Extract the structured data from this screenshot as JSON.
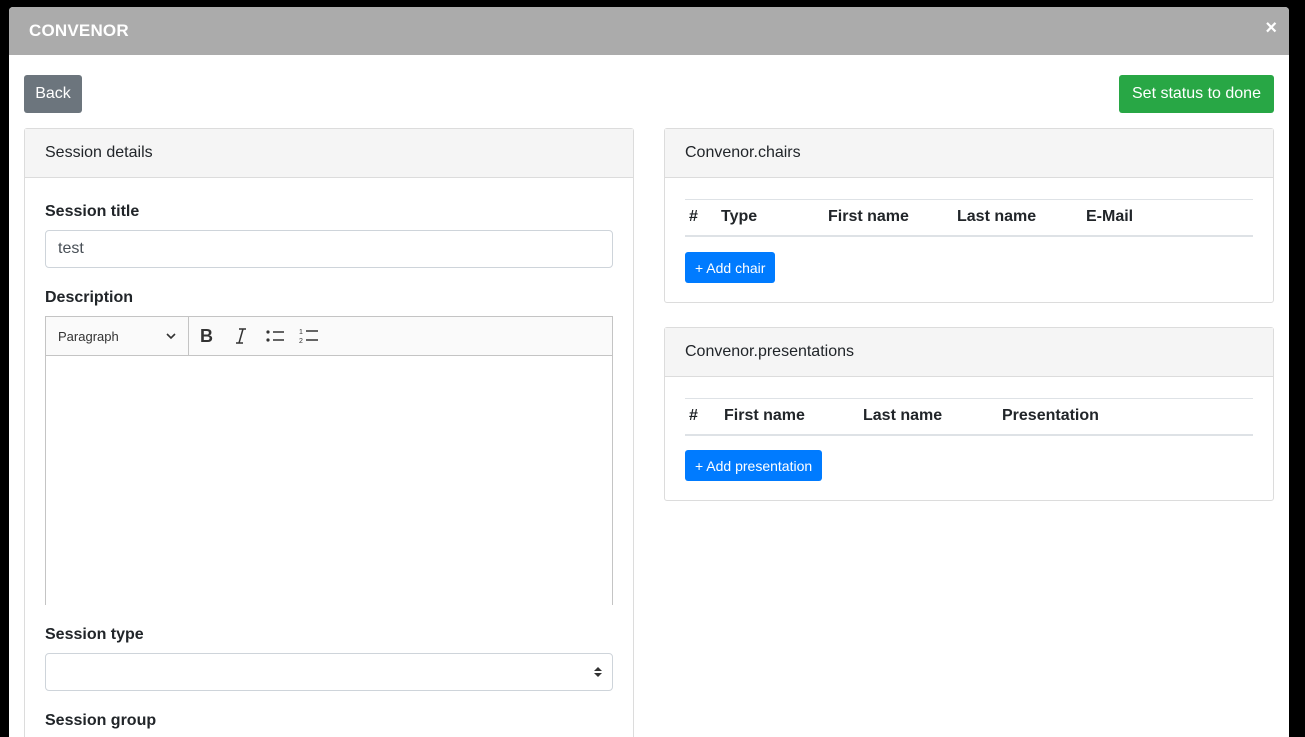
{
  "modal": {
    "title": "CONVENOR",
    "close_glyph": "×"
  },
  "actions": {
    "back_label": "Back",
    "done_label": "Set status to done"
  },
  "session": {
    "header": "Session details",
    "title_label": "Session title",
    "title_value": "test",
    "description_label": "Description",
    "editor": {
      "block_style": "Paragraph",
      "tools": [
        "bold-icon",
        "italic-icon",
        "bulleted-list-icon",
        "numbered-list-icon"
      ]
    },
    "type_label": "Session type",
    "type_value": "",
    "group_label": "Session group"
  },
  "chairs": {
    "header": "Convenor.chairs",
    "columns": [
      "#",
      "Type",
      "First name",
      "Last name",
      "E-Mail"
    ],
    "add_label": "+ Add chair"
  },
  "presentations": {
    "header": "Convenor.presentations",
    "columns": [
      "#",
      "First name",
      "Last name",
      "Presentation"
    ],
    "add_label": "+ Add presentation"
  },
  "colors": {
    "header_bg": "#ababab",
    "back": "#6c757d",
    "done": "#28a745",
    "add": "#007bff"
  }
}
